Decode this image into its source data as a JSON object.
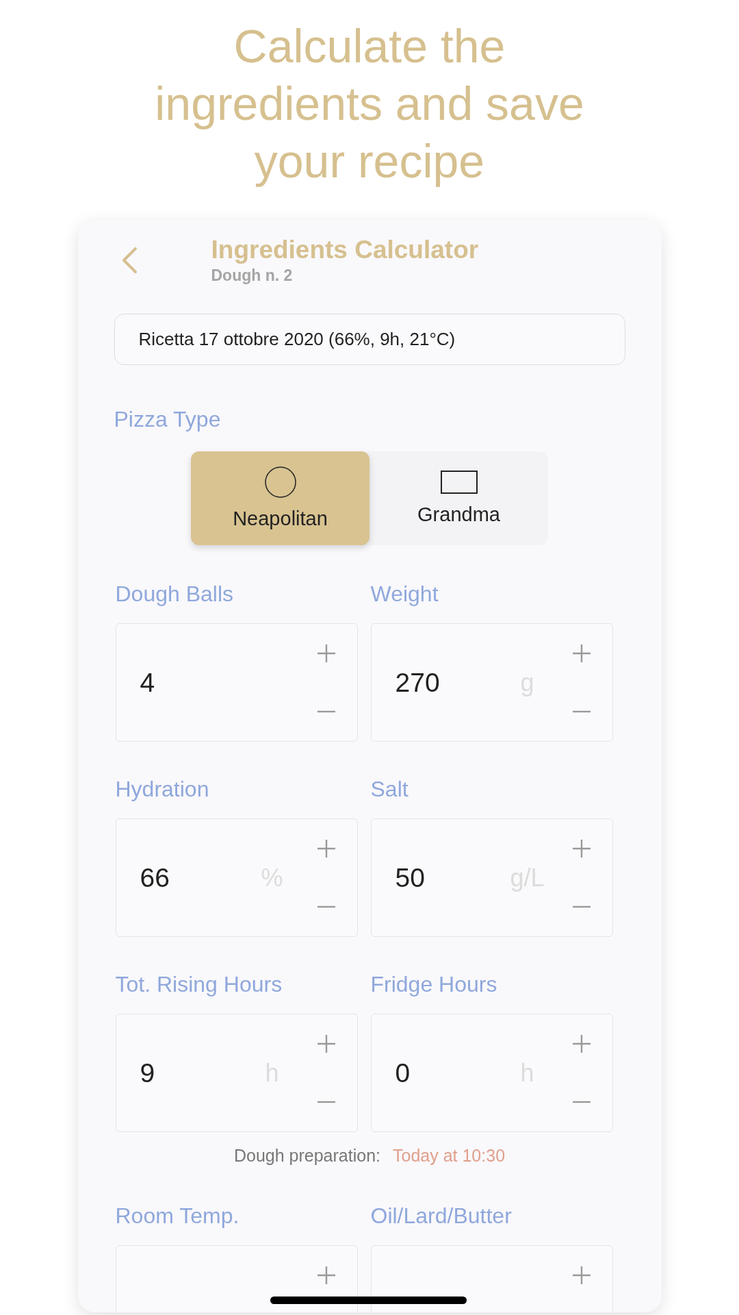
{
  "headline": "Calculate the ingredients and save your recipe",
  "header": {
    "title": "Ingredients Calculator",
    "subtitle": "Dough n. 2"
  },
  "recipe_name": {
    "value": "Ricetta 17 ottobre 2020 (66%, 9h, 21°C)"
  },
  "pizza_type": {
    "label": "Pizza Type",
    "options": [
      {
        "label": "Neapolitan",
        "kind": "round",
        "selected": true
      },
      {
        "label": "Grandma",
        "kind": "rectangle",
        "selected": false
      }
    ]
  },
  "field_groups": [
    {
      "fields": [
        {
          "label": "Dough Balls",
          "value": "4"
        },
        {
          "label": "Weight",
          "value": "270",
          "unit": "g"
        },
        {
          "label": "Hydration",
          "value": "66",
          "unit": "%"
        },
        {
          "label": "Salt",
          "value": "50",
          "unit": "g/L"
        },
        {
          "label": "Tot. Rising Hours",
          "value": "9",
          "unit": "h"
        },
        {
          "label": "Fridge Hours",
          "value": "0",
          "unit": "h"
        }
      ],
      "note": {
        "label": "Dough preparation:",
        "value": "Today at 10:30"
      }
    },
    {
      "fields": [
        {
          "label": "Room Temp."
        },
        {
          "label": "Oil/Lard/Butter"
        }
      ]
    }
  ]
}
